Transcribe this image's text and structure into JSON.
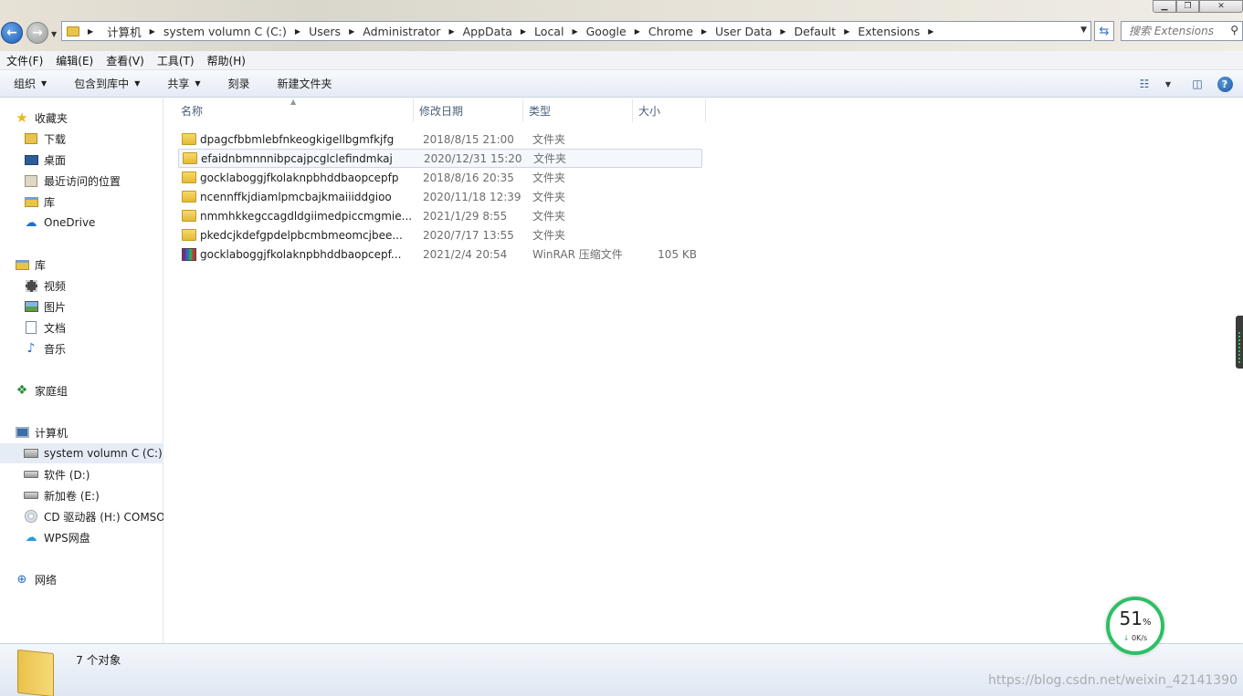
{
  "window": {
    "address": {
      "crumbs": [
        "计算机",
        "system volumn C (C:)",
        "Users",
        "Administrator",
        "AppData",
        "Local",
        "Google",
        "Chrome",
        "User Data",
        "Default",
        "Extensions"
      ]
    },
    "search": {
      "placeholder": "搜索 Extensions"
    }
  },
  "menubar": {
    "items": [
      "文件(F)",
      "编辑(E)",
      "查看(V)",
      "工具(T)",
      "帮助(H)"
    ]
  },
  "toolbar": {
    "organize": "组织",
    "include_library": "包含到库中",
    "share": "共享",
    "burn": "刻录",
    "new_folder": "新建文件夹"
  },
  "sidebar": {
    "favorites": {
      "label": "收藏夹",
      "items": [
        "下载",
        "桌面",
        "最近访问的位置",
        "库",
        "OneDrive"
      ]
    },
    "libraries": {
      "label": "库",
      "items": [
        "视频",
        "图片",
        "文档",
        "音乐"
      ]
    },
    "homegroup": {
      "label": "家庭组"
    },
    "computer": {
      "label": "计算机",
      "items": [
        "system volumn C (C:)",
        "软件 (D:)",
        "新加卷 (E:)",
        "CD 驱动器 (H:) COMSOL",
        "WPS网盘"
      ]
    },
    "network": {
      "label": "网络"
    }
  },
  "columns": {
    "name": "名称",
    "date": "修改日期",
    "type": "类型",
    "size": "大小"
  },
  "files": [
    {
      "name": "dpagcfbbmlebfnkeogkigellbgmfkjfg",
      "date": "2018/8/15 21:00",
      "type": "文件夹",
      "size": "",
      "icon": "folder-icon"
    },
    {
      "name": "efaidnbmnnnibpcajpcglclefindmkaj",
      "date": "2020/12/31 15:20",
      "type": "文件夹",
      "size": "",
      "icon": "folder-icon"
    },
    {
      "name": "gocklaboggjfkolaknpbhddbaopcepfp",
      "date": "2018/8/16 20:35",
      "type": "文件夹",
      "size": "",
      "icon": "folder-icon"
    },
    {
      "name": "ncennffkjdiamlpmcbajkmaiiiddgioo",
      "date": "2020/11/18 12:39",
      "type": "文件夹",
      "size": "",
      "icon": "folder-icon"
    },
    {
      "name": "nmmhkkegccagdldgiimedpiccmgmie...",
      "date": "2021/1/29 8:55",
      "type": "文件夹",
      "size": "",
      "icon": "folder-icon"
    },
    {
      "name": "pkedcjkdefgpdelpbcmbmeomcjbee...",
      "date": "2020/7/17 13:55",
      "type": "文件夹",
      "size": "",
      "icon": "folder-icon"
    },
    {
      "name": "gocklaboggjfkolaknpbhddbaopcepf...",
      "date": "2021/2/4 20:54",
      "type": "WinRAR 压缩文件",
      "size": "105 KB",
      "icon": "winrar-icon"
    }
  ],
  "status": {
    "count": "7 个对象"
  },
  "speed_widget": {
    "percent": "51",
    "percent_unit": "%",
    "speed": "0K/s"
  },
  "watermark": "https://blog.csdn.net/weixin_42141390"
}
